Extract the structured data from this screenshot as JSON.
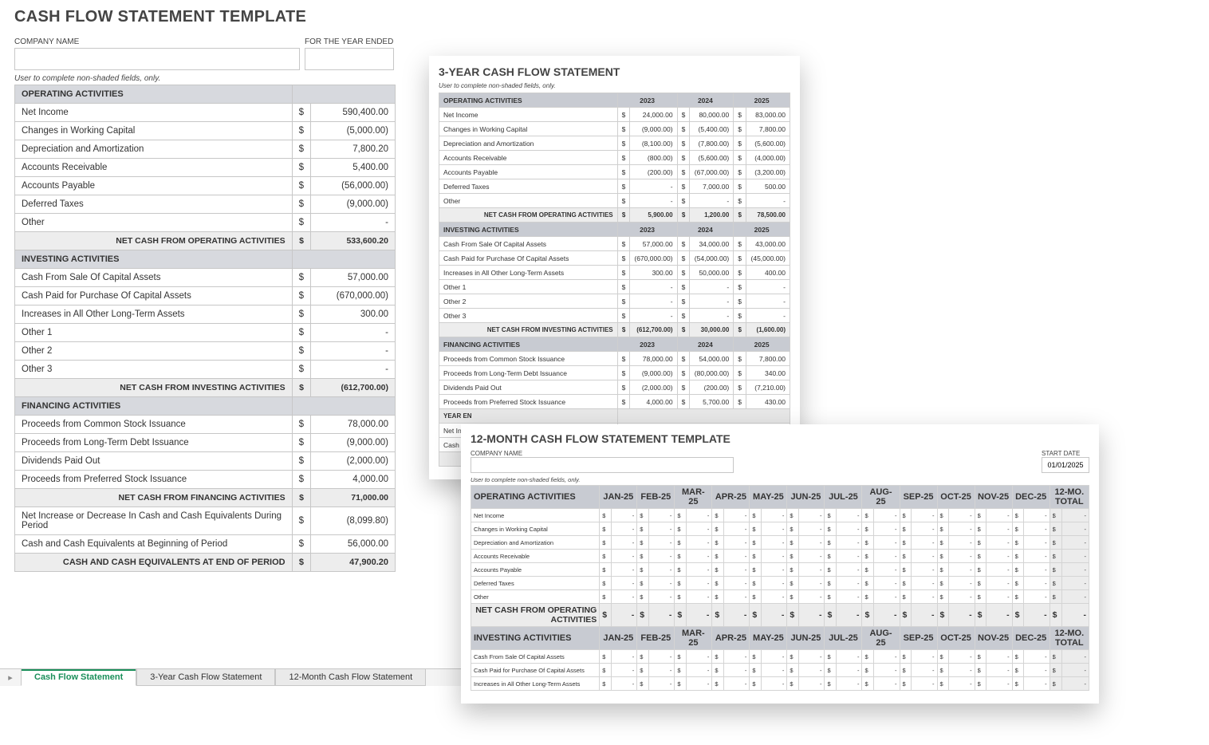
{
  "main": {
    "title": "CASH FLOW STATEMENT TEMPLATE",
    "company_label": "COMPANY NAME",
    "year_label": "FOR THE YEAR ENDED",
    "user_note": "User to complete non-shaded fields, only.",
    "sections": {
      "operating": {
        "header": "OPERATING ACTIVITIES",
        "rows": [
          {
            "label": "Net Income",
            "cur": "$",
            "amt": "590,400.00",
            "neg": false
          },
          {
            "label": "Changes in Working Capital",
            "cur": "$",
            "amt": "(5,000.00)",
            "neg": true
          },
          {
            "label": "Depreciation and Amortization",
            "cur": "$",
            "amt": "7,800.20",
            "neg": false
          },
          {
            "label": "Accounts Receivable",
            "cur": "$",
            "amt": "5,400.00",
            "neg": false
          },
          {
            "label": "Accounts Payable",
            "cur": "$",
            "amt": "(56,000.00)",
            "neg": true
          },
          {
            "label": "Deferred Taxes",
            "cur": "$",
            "amt": "(9,000.00)",
            "neg": true
          },
          {
            "label": "Other",
            "cur": "$",
            "amt": "-",
            "neg": false
          }
        ],
        "subtotal_label": "NET CASH FROM OPERATING ACTIVITIES",
        "subtotal_cur": "$",
        "subtotal_amt": "533,600.20",
        "subtotal_neg": false
      },
      "investing": {
        "header": "INVESTING ACTIVITIES",
        "rows": [
          {
            "label": "Cash From Sale Of Capital Assets",
            "cur": "$",
            "amt": "57,000.00",
            "neg": false
          },
          {
            "label": "Cash Paid for Purchase Of Capital Assets",
            "cur": "$",
            "amt": "(670,000.00)",
            "neg": true
          },
          {
            "label": "Increases in All Other Long-Term Assets",
            "cur": "$",
            "amt": "300.00",
            "neg": false
          },
          {
            "label": "Other 1",
            "cur": "$",
            "amt": "-",
            "neg": false
          },
          {
            "label": "Other 2",
            "cur": "$",
            "amt": "-",
            "neg": false
          },
          {
            "label": "Other 3",
            "cur": "$",
            "amt": "-",
            "neg": false
          }
        ],
        "subtotal_label": "NET CASH FROM INVESTING ACTIVITIES",
        "subtotal_cur": "$",
        "subtotal_amt": "(612,700.00)",
        "subtotal_neg": true
      },
      "financing": {
        "header": "FINANCING ACTIVITIES",
        "rows": [
          {
            "label": "Proceeds from Common Stock Issuance",
            "cur": "$",
            "amt": "78,000.00",
            "neg": false
          },
          {
            "label": "Proceeds from Long-Term Debt Issuance",
            "cur": "$",
            "amt": "(9,000.00)",
            "neg": true
          },
          {
            "label": "Dividends Paid Out",
            "cur": "$",
            "amt": "(2,000.00)",
            "neg": true
          },
          {
            "label": "Proceeds from Preferred Stock Issuance",
            "cur": "$",
            "amt": "4,000.00",
            "neg": false
          }
        ],
        "subtotal_label": "NET CASH FROM FINANCING ACTIVITIES",
        "subtotal_cur": "$",
        "subtotal_amt": "71,000.00",
        "subtotal_neg": false
      }
    },
    "summary": [
      {
        "label": "Net Increase or Decrease In Cash and Cash Equivalents During Period",
        "cur": "$",
        "amt": "(8,099.80)",
        "neg": true,
        "bold": false
      },
      {
        "label": "Cash and Cash Equivalents at Beginning of Period",
        "cur": "$",
        "amt": "56,000.00",
        "neg": false,
        "bold": false
      },
      {
        "label": "CASH AND CASH EQUIVALENTS AT END OF PERIOD",
        "cur": "$",
        "amt": "47,900.20",
        "neg": false,
        "bold": true
      }
    ]
  },
  "tabs": {
    "t1": "Cash Flow Statement",
    "t2": "3-Year Cash Flow Statement",
    "t3": "12-Month Cash Flow Statement"
  },
  "three_year": {
    "title": "3-YEAR CASH FLOW STATEMENT",
    "user_note": "User to complete non-shaded fields, only.",
    "years": [
      "2023",
      "2024",
      "2025"
    ],
    "operating": {
      "header": "OPERATING ACTIVITIES",
      "rows": [
        {
          "label": "Net Income",
          "v": [
            [
              "$",
              "24,000.00",
              false
            ],
            [
              "$",
              "80,000.00",
              false
            ],
            [
              "$",
              "83,000.00",
              false
            ]
          ]
        },
        {
          "label": "Changes in Working Capital",
          "v": [
            [
              "$",
              "(9,000.00)",
              true
            ],
            [
              "$",
              "(5,400.00)",
              true
            ],
            [
              "$",
              "7,800.00",
              false
            ]
          ]
        },
        {
          "label": "Depreciation and Amortization",
          "v": [
            [
              "$",
              "(8,100.00)",
              true
            ],
            [
              "$",
              "(7,800.00)",
              true
            ],
            [
              "$",
              "(5,600.00)",
              true
            ]
          ]
        },
        {
          "label": "Accounts Receivable",
          "v": [
            [
              "$",
              "(800.00)",
              true
            ],
            [
              "$",
              "(5,600.00)",
              true
            ],
            [
              "$",
              "(4,000.00)",
              true
            ]
          ]
        },
        {
          "label": "Accounts Payable",
          "v": [
            [
              "$",
              "(200.00)",
              true
            ],
            [
              "$",
              "(67,000.00)",
              true
            ],
            [
              "$",
              "(3,200.00)",
              true
            ]
          ]
        },
        {
          "label": "Deferred Taxes",
          "v": [
            [
              "$",
              "-",
              false
            ],
            [
              "$",
              "7,000.00",
              false
            ],
            [
              "$",
              "500.00",
              false
            ]
          ]
        },
        {
          "label": "Other",
          "v": [
            [
              "$",
              "-",
              false
            ],
            [
              "$",
              "-",
              false
            ],
            [
              "$",
              "-",
              false
            ]
          ]
        }
      ],
      "subtotal": {
        "label": "NET CASH FROM OPERATING ACTIVITIES",
        "v": [
          [
            "$",
            "5,900.00",
            false
          ],
          [
            "$",
            "1,200.00",
            false
          ],
          [
            "$",
            "78,500.00",
            false
          ]
        ]
      }
    },
    "investing": {
      "header": "INVESTING ACTIVITIES",
      "rows": [
        {
          "label": "Cash From Sale Of Capital Assets",
          "v": [
            [
              "$",
              "57,000.00",
              false
            ],
            [
              "$",
              "34,000.00",
              false
            ],
            [
              "$",
              "43,000.00",
              false
            ]
          ]
        },
        {
          "label": "Cash Paid for Purchase Of Capital Assets",
          "v": [
            [
              "$",
              "(670,000.00)",
              true
            ],
            [
              "$",
              "(54,000.00)",
              true
            ],
            [
              "$",
              "(45,000.00)",
              true
            ]
          ]
        },
        {
          "label": "Increases in All Other Long-Term Assets",
          "v": [
            [
              "$",
              "300.00",
              false
            ],
            [
              "$",
              "50,000.00",
              false
            ],
            [
              "$",
              "400.00",
              false
            ]
          ]
        },
        {
          "label": "Other 1",
          "v": [
            [
              "$",
              "-",
              false
            ],
            [
              "$",
              "-",
              false
            ],
            [
              "$",
              "-",
              false
            ]
          ]
        },
        {
          "label": "Other 2",
          "v": [
            [
              "$",
              "-",
              false
            ],
            [
              "$",
              "-",
              false
            ],
            [
              "$",
              "-",
              false
            ]
          ]
        },
        {
          "label": "Other 3",
          "v": [
            [
              "$",
              "-",
              false
            ],
            [
              "$",
              "-",
              false
            ],
            [
              "$",
              "-",
              false
            ]
          ]
        }
      ],
      "subtotal": {
        "label": "NET CASH FROM INVESTING ACTIVITIES",
        "v": [
          [
            "$",
            "(612,700.00)",
            true
          ],
          [
            "$",
            "30,000.00",
            false
          ],
          [
            "$",
            "(1,600.00)",
            true
          ]
        ]
      }
    },
    "financing": {
      "header": "FINANCING ACTIVITIES",
      "rows": [
        {
          "label": "Proceeds from Common Stock Issuance",
          "v": [
            [
              "$",
              "78,000.00",
              false
            ],
            [
              "$",
              "54,000.00",
              false
            ],
            [
              "$",
              "7,800.00",
              false
            ]
          ]
        },
        {
          "label": "Proceeds from Long-Term Debt Issuance",
          "v": [
            [
              "$",
              "(9,000.00)",
              true
            ],
            [
              "$",
              "(80,000.00)",
              true
            ],
            [
              "$",
              "340.00",
              false
            ]
          ]
        },
        {
          "label": "Dividends Paid Out",
          "v": [
            [
              "$",
              "(2,000.00)",
              true
            ],
            [
              "$",
              "(200.00)",
              true
            ],
            [
              "$",
              "(7,210.00)",
              true
            ]
          ]
        },
        {
          "label": "Proceeds from Preferred Stock Issuance",
          "v": [
            [
              "$",
              "4,000.00",
              false
            ],
            [
              "$",
              "5,700.00",
              false
            ],
            [
              "$",
              "430.00",
              false
            ]
          ]
        }
      ]
    },
    "yearend": {
      "label": "YEAR EN",
      "sub1": "Net Incre",
      "sub2": "Cash an"
    }
  },
  "twelve_month": {
    "title": "12-MONTH CASH FLOW STATEMENT TEMPLATE",
    "company_label": "COMPANY NAME",
    "start_label": "START DATE",
    "start_value": "01/01/2025",
    "user_note": "User to complete non-shaded fields, only.",
    "months": [
      "Jan-25",
      "Feb-25",
      "Mar-25",
      "Apr-25",
      "May-25",
      "Jun-25",
      "Jul-25",
      "Aug-25",
      "Sep-25",
      "Oct-25",
      "Nov-25",
      "Dec-25",
      "12-Mo. TOTAL"
    ],
    "operating": {
      "header": "OPERATING ACTIVITIES",
      "rows": [
        "Net Income",
        "Changes in Working Capital",
        "Depreciation and Amortization",
        "Accounts Receivable",
        "Accounts Payable",
        "Deferred Taxes",
        "Other"
      ],
      "subtotal": "NET CASH FROM OPERATING ACTIVITIES"
    },
    "investing": {
      "header": "INVESTING ACTIVITIES",
      "rows": [
        "Cash From Sale Of Capital Assets",
        "Cash Paid for Purchase Of Capital Assets",
        "Increases in All Other Long-Term Assets"
      ]
    },
    "cell_cur": "$",
    "cell_amt": "-"
  }
}
